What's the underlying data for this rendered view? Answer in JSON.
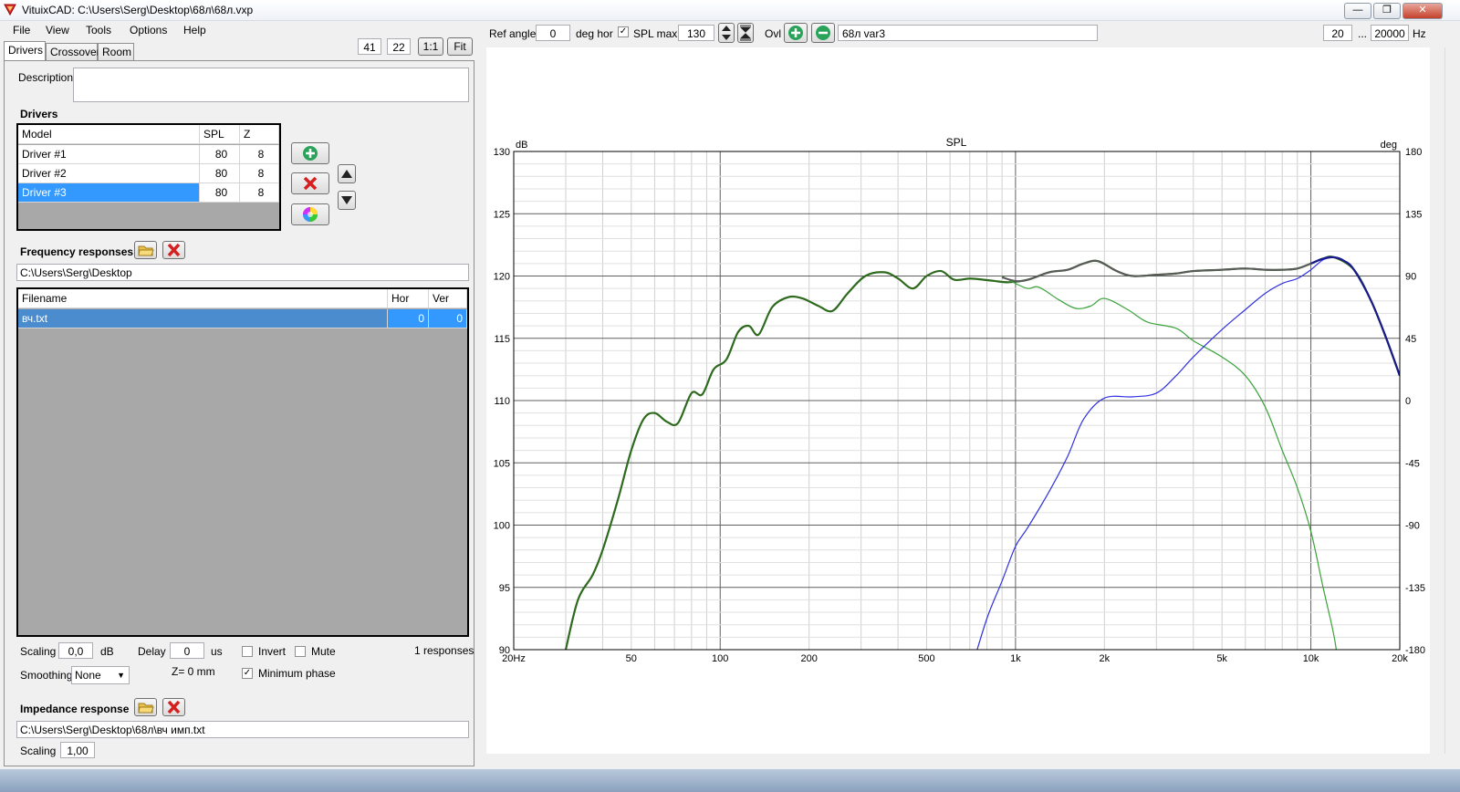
{
  "window": {
    "title": "VituixCAD: C:\\Users\\Serg\\Desktop\\68л\\68л.vxp",
    "buttons": {
      "minimize": "—",
      "maximize": "❐",
      "close": "✕"
    }
  },
  "menu": {
    "file": "File",
    "view": "View",
    "tools": "Tools",
    "options": "Options",
    "help": "Help"
  },
  "zoom": {
    "a": "41",
    "b": "22",
    "one_to_one": "1:1",
    "fit": "Fit"
  },
  "tabs": [
    {
      "label": "Drivers"
    },
    {
      "label": "Crossover"
    },
    {
      "label": "Room"
    }
  ],
  "description": {
    "label": "Description",
    "value": ""
  },
  "drivers": {
    "heading": "Drivers",
    "columns": [
      "Model",
      "SPL",
      "Z"
    ],
    "rows": [
      {
        "model": "Driver #1",
        "spl": "80",
        "z": "8"
      },
      {
        "model": "Driver #2",
        "spl": "80",
        "z": "8"
      },
      {
        "model": "Driver #3",
        "spl": "80",
        "z": "8"
      }
    ]
  },
  "freq": {
    "heading": "Frequency responses",
    "path": "C:\\Users\\Serg\\Desktop",
    "columns": [
      "Filename",
      "Hor",
      "Ver"
    ],
    "rows": [
      {
        "file": "вч.txt",
        "hor": "0",
        "ver": "0"
      }
    ]
  },
  "params": {
    "scaling_label": "Scaling",
    "scaling_value": "0,0",
    "scaling_unit": "dB",
    "delay_label": "Delay",
    "delay_value": "0",
    "delay_unit": "us",
    "invert_label": "Invert",
    "mute_label": "Mute",
    "responses": "1 responses",
    "smoothing_label": "Smoothing",
    "smoothing_value": "None",
    "z_info": "Z= 0 mm",
    "minphase_label": "Minimum phase"
  },
  "impedance": {
    "heading": "Impedance response",
    "path": "C:\\Users\\Serg\\Desktop\\68л\\вч имп.txt",
    "scaling_label": "Scaling",
    "scaling_value": "1,00"
  },
  "toolbar": {
    "ref_angle_label": "Ref angle",
    "ref_angle_value": "0",
    "deg_hor": "deg hor",
    "spl_max_label": "SPL max",
    "spl_max_value": "130",
    "ovl": "Ovl",
    "variant_name": "68л var3",
    "fmin": "20",
    "ellipsis": "...",
    "fmax": "20000",
    "hz": "Hz"
  },
  "chart_data": {
    "type": "line",
    "title": "SPL",
    "ylabel": "dB",
    "y2label": "deg",
    "x_scale": "log",
    "xlim": [
      20,
      20000
    ],
    "ylim": [
      90,
      130
    ],
    "y2lim": [
      -180,
      180
    ],
    "x_ticks": [
      {
        "value": 20,
        "label": "20Hz"
      },
      {
        "value": 50,
        "label": "50"
      },
      {
        "value": 100,
        "label": "100"
      },
      {
        "value": 200,
        "label": "200"
      },
      {
        "value": 500,
        "label": "500"
      },
      {
        "value": 1000,
        "label": "1k"
      },
      {
        "value": 2000,
        "label": "2k"
      },
      {
        "value": 5000,
        "label": "5k"
      },
      {
        "value": 10000,
        "label": "10k"
      },
      {
        "value": 20000,
        "label": "20k"
      }
    ],
    "y_ticks": [
      "90",
      "95",
      "100",
      "105",
      "110",
      "115",
      "120",
      "125",
      "130"
    ],
    "y2_ticks": [
      "-180",
      "-135",
      "-90",
      "-45",
      "0",
      "45",
      "90",
      "135",
      "180"
    ],
    "grid": true,
    "series": [
      {
        "color": "#2e6a1e",
        "points": [
          [
            30,
            90
          ],
          [
            33,
            94
          ],
          [
            37,
            96
          ],
          [
            40,
            98
          ],
          [
            45,
            102
          ],
          [
            50,
            106
          ],
          [
            55,
            108.5
          ],
          [
            60,
            109
          ],
          [
            66,
            108.3
          ],
          [
            72,
            108.2
          ],
          [
            80,
            110.6
          ],
          [
            87,
            110.5
          ],
          [
            95,
            112.5
          ],
          [
            105,
            113.3
          ],
          [
            115,
            115.5
          ],
          [
            125,
            116
          ],
          [
            135,
            115.3
          ],
          [
            150,
            117.5
          ],
          [
            170,
            118.3
          ],
          [
            190,
            118.2
          ],
          [
            215,
            117.6
          ],
          [
            240,
            117.2
          ],
          [
            270,
            118.6
          ],
          [
            310,
            120
          ],
          [
            360,
            120.3
          ],
          [
            400,
            119.8
          ],
          [
            450,
            119
          ],
          [
            500,
            120
          ],
          [
            560,
            120.4
          ],
          [
            620,
            119.7
          ],
          [
            700,
            119.8
          ],
          [
            780,
            119.7
          ],
          [
            850,
            119.6
          ],
          [
            950,
            119.5
          ],
          [
            1100,
            119.7
          ],
          [
            1300,
            120.3
          ],
          [
            1500,
            120.5
          ],
          [
            1700,
            121
          ],
          [
            1900,
            121.2
          ],
          [
            2200,
            120.4
          ],
          [
            2500,
            120.0
          ],
          [
            3000,
            120.1
          ],
          [
            3500,
            120.2
          ],
          [
            4000,
            120.4
          ],
          [
            5000,
            120.5
          ],
          [
            6000,
            120.6
          ],
          [
            7000,
            120.5
          ],
          [
            8000,
            120.5
          ],
          [
            9000,
            120.6
          ],
          [
            10000,
            121
          ],
          [
            11000,
            121.4
          ],
          [
            12000,
            121.5
          ],
          [
            14000,
            120.5
          ],
          [
            16000,
            118
          ],
          [
            18000,
            115
          ],
          [
            20000,
            112
          ]
        ]
      },
      {
        "color": "#3aa23a",
        "points": [
          [
            900,
            120
          ],
          [
            1000,
            119.4
          ],
          [
            1100,
            119
          ],
          [
            1200,
            119.1
          ],
          [
            1400,
            118.1
          ],
          [
            1600,
            117.4
          ],
          [
            1800,
            117.6
          ],
          [
            2000,
            118.2
          ],
          [
            2400,
            117.3
          ],
          [
            2800,
            116.3
          ],
          [
            3500,
            115.8
          ],
          [
            4000,
            114.8
          ],
          [
            5000,
            113.5
          ],
          [
            6000,
            112
          ],
          [
            7000,
            109.5
          ],
          [
            8000,
            106
          ],
          [
            9000,
            103
          ],
          [
            10000,
            99.5
          ],
          [
            11000,
            95
          ],
          [
            12000,
            91
          ],
          [
            12500,
            88
          ]
        ]
      },
      {
        "color": "#3030e0",
        "points": [
          [
            700,
            88
          ],
          [
            800,
            92.5
          ],
          [
            900,
            95.5
          ],
          [
            1000,
            98.3
          ],
          [
            1100,
            99.8
          ],
          [
            1300,
            102.7
          ],
          [
            1500,
            105.5
          ],
          [
            1700,
            108.5
          ],
          [
            2000,
            110.2
          ],
          [
            2500,
            110.3
          ],
          [
            3000,
            110.6
          ],
          [
            3500,
            112
          ],
          [
            4000,
            113.5
          ],
          [
            5000,
            115.7
          ],
          [
            6000,
            117.3
          ],
          [
            7000,
            118.6
          ],
          [
            8000,
            119.4
          ],
          [
            9000,
            119.8
          ],
          [
            10000,
            120.5
          ],
          [
            11000,
            121.3
          ],
          [
            12000,
            121.5
          ]
        ]
      },
      {
        "color": "#1a1a8c",
        "points": [
          [
            10000,
            121
          ],
          [
            11000,
            121.4
          ],
          [
            12000,
            121.5
          ],
          [
            13000,
            121.2
          ],
          [
            14000,
            120.5
          ],
          [
            16000,
            118
          ],
          [
            18000,
            115
          ],
          [
            20000,
            112
          ]
        ]
      },
      {
        "color": "#5a5a5a",
        "points": [
          [
            900,
            119.9
          ],
          [
            1000,
            119.6
          ],
          [
            1100,
            119.7
          ],
          [
            1300,
            120.3
          ],
          [
            1500,
            120.5
          ],
          [
            1700,
            121
          ],
          [
            1900,
            121.2
          ],
          [
            2200,
            120.4
          ],
          [
            2500,
            120.0
          ],
          [
            3000,
            120.1
          ],
          [
            3500,
            120.2
          ],
          [
            4000,
            120.4
          ],
          [
            5000,
            120.5
          ],
          [
            6000,
            120.6
          ],
          [
            7000,
            120.5
          ],
          [
            8000,
            120.5
          ],
          [
            9000,
            120.6
          ],
          [
            10000,
            121
          ]
        ]
      }
    ]
  }
}
